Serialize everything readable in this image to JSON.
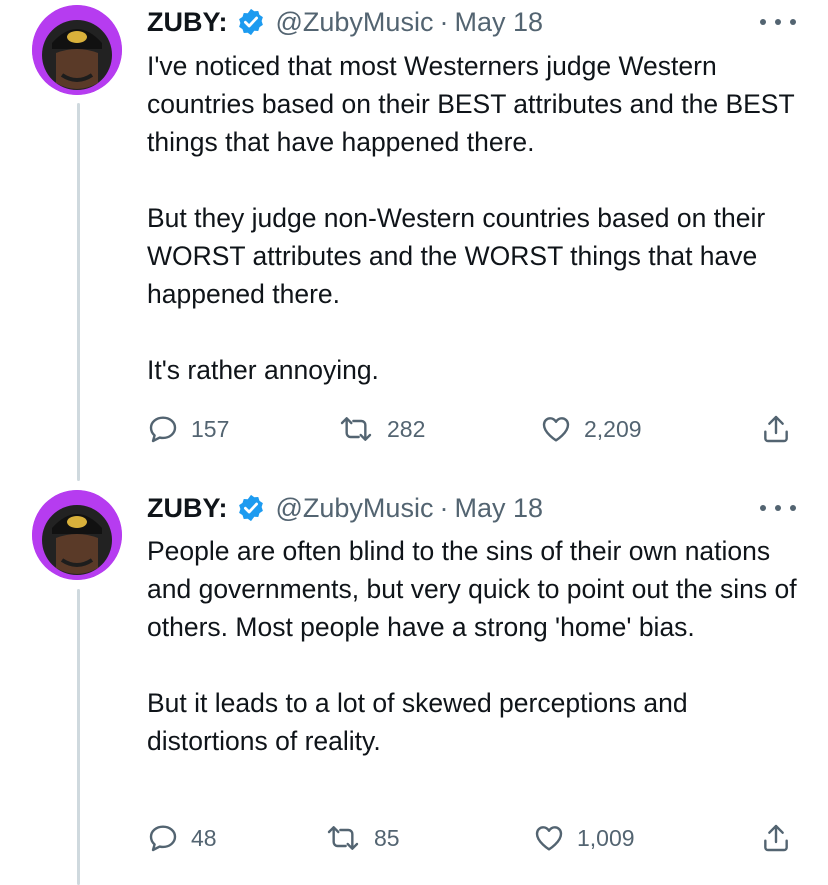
{
  "tweets": [
    {
      "name": "ZUBY:",
      "handle": "@ZubyMusic",
      "separator": "·",
      "date": "May 18",
      "paragraphs": [
        "I've noticed that most Westerners judge Western countries based on their BEST attributes and the BEST things that have happened there.",
        "But they judge non-Western countries based on their WORST attributes and the WORST things that have happened there.",
        "It's rather annoying."
      ],
      "replies": "157",
      "retweets": "282",
      "likes": "2,209"
    },
    {
      "name": "ZUBY:",
      "handle": "@ZubyMusic",
      "separator": "·",
      "date": "May 18",
      "paragraphs": [
        "People are often blind to the sins of their own nations and governments, but very quick to point out the sins of others. Most people have a strong 'home' bias.",
        "But it leads to a lot of skewed perceptions and distortions of reality."
      ],
      "replies": "48",
      "retweets": "85",
      "likes": "1,009"
    }
  ],
  "colors": {
    "text": "#0f1419",
    "muted": "#536471",
    "verified": "#1d9bf0",
    "thread_line": "#cfd9de",
    "avatar_bg": "#b63cf0"
  },
  "icons": [
    "verified-badge-icon",
    "more-icon",
    "reply-icon",
    "retweet-icon",
    "like-icon",
    "share-icon"
  ]
}
